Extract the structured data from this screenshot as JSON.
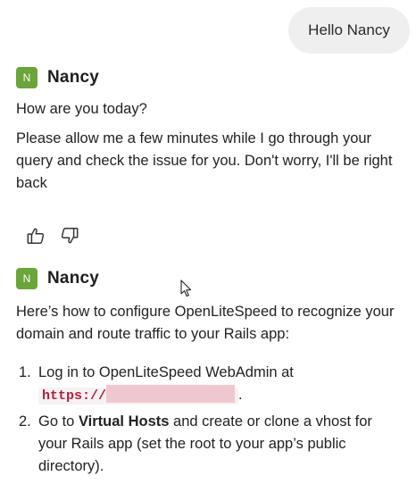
{
  "user_message": {
    "text": "Hello Nancy"
  },
  "agent": {
    "initial": "N",
    "name": "Nancy"
  },
  "message1": {
    "greeting": "How are you today?",
    "body": "Please allow me a few minutes while I go through your query and check the issue for you. Don't worry, I'll be right back"
  },
  "feedback": {
    "thumbs_up_icon": "thumbs-up-icon",
    "thumbs_down_icon": "thumbs-down-icon"
  },
  "message2": {
    "intro": "Here’s how to configure OpenLiteSpeed to recognize your domain and route traffic to your Rails app:",
    "steps": [
      {
        "num": "1.",
        "text_before": "Log in to OpenLiteSpeed WebAdmin at",
        "url_prefix": "https://",
        "text_after": "."
      },
      {
        "num": "2.",
        "text_before": "Go to ",
        "bold": "Virtual Hosts",
        "text_after": " and create or clone a vhost for your Rails app (set the root to your app’s public directory)."
      }
    ]
  },
  "colors": {
    "avatar_bg": "#6aa43a",
    "user_bubble_bg": "#efefef",
    "url_color": "#b0223a",
    "redaction": "#efc8cf"
  }
}
